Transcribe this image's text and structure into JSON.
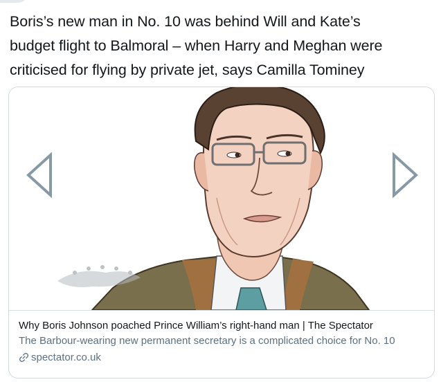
{
  "tweet": {
    "text_line1": "Boris’s new man in No. 10 was behind Will and Kate’s",
    "text_line2": "budget flight to Balmoral – when Harry and Meghan were",
    "text_line3": "criticised for flying by private jet, says Camilla Tominey"
  },
  "card": {
    "title": "Why Boris Johnson poached Prince William’s right-hand man | The Spectator",
    "description": "The Barbour-wearing new permanent secretary is a complicated choice for No. 10",
    "domain": "spectator.co.uk",
    "image_icon": "illustrated-portrait",
    "prev_icon": "chevron-left-icon",
    "next_icon": "chevron-right-icon"
  },
  "colors": {
    "text": "#14171a",
    "secondary": "#5b7083",
    "border": "#cfd9de",
    "arrow": "#8899a6"
  }
}
